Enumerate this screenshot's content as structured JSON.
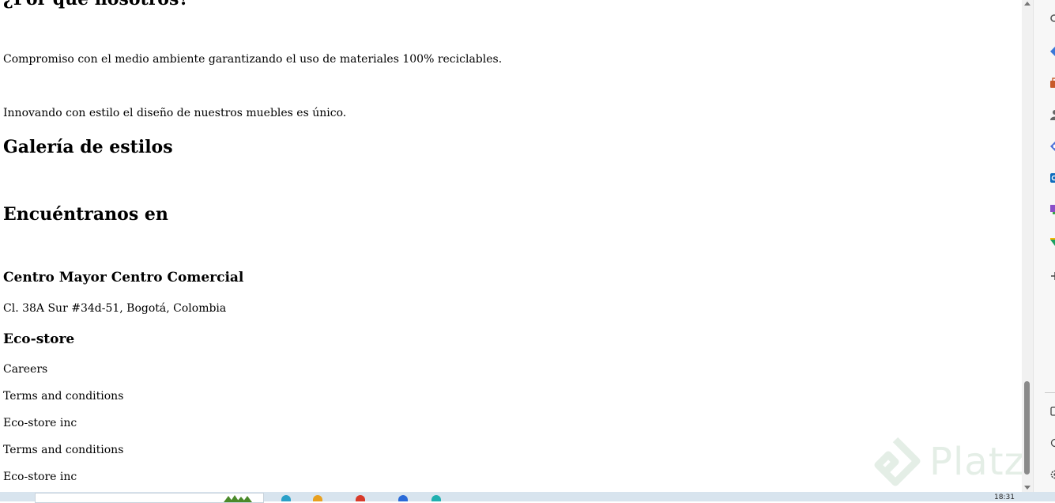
{
  "content": {
    "why_us_heading": "¿Por qué nosotros?",
    "paragraph_1": "Compromiso con el medio ambiente garantizando el uso de materiales 100% reciclables.",
    "paragraph_2": "Innovando con estilo el diseño de nuestros muebles es único.",
    "gallery_heading": "Galería de estilos",
    "find_us_heading": "Encuéntranos en",
    "location_name": "Centro Mayor Centro Comercial",
    "location_address": "Cl. 38A Sur #34d-51, Bogotá, Colombia",
    "footer_heading": "Eco-store",
    "footer_links": [
      "Careers",
      "Terms and conditions",
      "Eco-store inc",
      "Terms and conditions",
      "Eco-store inc"
    ]
  },
  "taskbar": {
    "clock": "18:31"
  },
  "watermark": {
    "text": "Platzi",
    "color": "#2a7a3b"
  },
  "sidebar": {
    "icons": [
      "search-icon",
      "diamond-icon",
      "briefcase-icon",
      "user-icon",
      "copilot-icon",
      "outlook-icon",
      "apps-icon",
      "drive-icon",
      "add-icon",
      "window-icon",
      "refresh-icon",
      "settings-icon"
    ]
  }
}
